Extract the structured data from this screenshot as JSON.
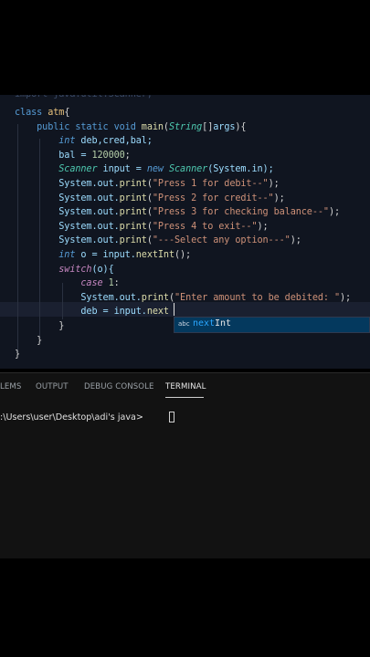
{
  "editor": {
    "partial_top": "import java.util.Scanner;",
    "cursor_line_index": 14,
    "lines": [
      [
        {
          "t": "class ",
          "c": "kw"
        },
        {
          "t": "atm",
          "c": "cls"
        },
        {
          "t": "{",
          "c": "pl"
        }
      ],
      [
        {
          "t": "    public static void ",
          "c": "kw"
        },
        {
          "t": "main",
          "c": "fn"
        },
        {
          "t": "(",
          "c": "pl"
        },
        {
          "t": "String",
          "c": "ty"
        },
        {
          "t": "[]",
          "c": "pl"
        },
        {
          "t": "args",
          "c": "var"
        },
        {
          "t": "){",
          "c": "pl"
        }
      ],
      [
        {
          "t": "        int ",
          "c": "kw"
        },
        {
          "t": "deb,cred,bal;",
          "c": "var"
        }
      ],
      [
        {
          "t": "        bal = ",
          "c": "var"
        },
        {
          "t": "120000",
          "c": "num"
        },
        {
          "t": ";",
          "c": "pl"
        }
      ],
      [
        {
          "t": "        Scanner ",
          "c": "ty"
        },
        {
          "t": "input = ",
          "c": "var"
        },
        {
          "t": "new ",
          "c": "kw"
        },
        {
          "t": "Scanner",
          "c": "ty"
        },
        {
          "t": "(System.in);",
          "c": "var"
        }
      ],
      [
        {
          "t": "        System.out.",
          "c": "var"
        },
        {
          "t": "print",
          "c": "fn"
        },
        {
          "t": "(",
          "c": "pl"
        },
        {
          "t": "\"Press 1 for debit--\"",
          "c": "str"
        },
        {
          "t": ");",
          "c": "pl"
        }
      ],
      [
        {
          "t": "        System.out.",
          "c": "var"
        },
        {
          "t": "print",
          "c": "fn"
        },
        {
          "t": "(",
          "c": "pl"
        },
        {
          "t": "\"Press 2 for credit--\"",
          "c": "str"
        },
        {
          "t": ");",
          "c": "pl"
        }
      ],
      [
        {
          "t": "        System.out.",
          "c": "var"
        },
        {
          "t": "print",
          "c": "fn"
        },
        {
          "t": "(",
          "c": "pl"
        },
        {
          "t": "\"Press 3 for checking balance--\"",
          "c": "str"
        },
        {
          "t": ");",
          "c": "pl"
        }
      ],
      [
        {
          "t": "        System.out.",
          "c": "var"
        },
        {
          "t": "print",
          "c": "fn"
        },
        {
          "t": "(",
          "c": "pl"
        },
        {
          "t": "\"Press 4 to exit--\"",
          "c": "str"
        },
        {
          "t": ");",
          "c": "pl"
        }
      ],
      [
        {
          "t": "        System.out.",
          "c": "var"
        },
        {
          "t": "print",
          "c": "fn"
        },
        {
          "t": "(",
          "c": "pl"
        },
        {
          "t": "\"---Select any option---\"",
          "c": "str"
        },
        {
          "t": ");",
          "c": "pl"
        }
      ],
      [
        {
          "t": "        int ",
          "c": "kw"
        },
        {
          "t": "o = input.",
          "c": "var"
        },
        {
          "t": "nextInt",
          "c": "fn"
        },
        {
          "t": "();",
          "c": "pl"
        }
      ],
      [
        {
          "t": "        switch",
          "c": "kw2"
        },
        {
          "t": "(o){",
          "c": "var"
        }
      ],
      [
        {
          "t": "            case ",
          "c": "kw2"
        },
        {
          "t": "1",
          "c": "num"
        },
        {
          "t": ":",
          "c": "pl"
        }
      ],
      [
        {
          "t": "            System.out.",
          "c": "var"
        },
        {
          "t": "print",
          "c": "fn"
        },
        {
          "t": "(",
          "c": "pl"
        },
        {
          "t": "\"Enter amount to be debited: \"",
          "c": "str"
        },
        {
          "t": ");",
          "c": "pl"
        }
      ],
      [
        {
          "t": "            deb = input.",
          "c": "var"
        },
        {
          "t": "next",
          "c": "fn"
        }
      ],
      [
        {
          "t": "        }",
          "c": "pl"
        }
      ],
      [
        {
          "t": "    }",
          "c": "pl"
        }
      ],
      [
        {
          "t": "}",
          "c": "pl"
        }
      ]
    ]
  },
  "suggest": {
    "kind": "abc",
    "match": "next",
    "rest": "Int"
  },
  "panel": {
    "tabs": [
      {
        "label": "LEMS",
        "active": false
      },
      {
        "label": "OUTPUT",
        "active": false
      },
      {
        "label": "DEBUG CONSOLE",
        "active": false
      },
      {
        "label": "TERMINAL",
        "active": true
      }
    ],
    "terminal_prompt": ":\\Users\\user\\Desktop\\adi's java> "
  }
}
